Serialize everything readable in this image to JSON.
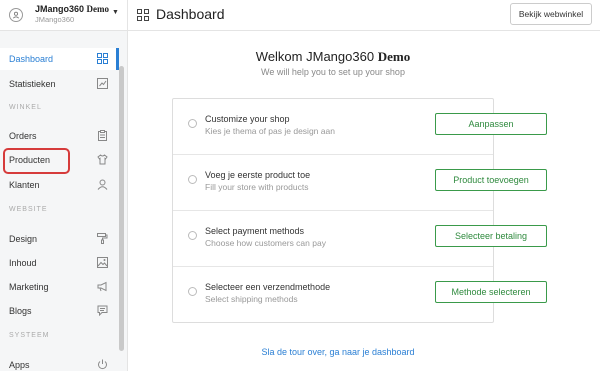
{
  "account": {
    "name": "JMango360",
    "name_suffix": "Demo",
    "subtitle": "JMango360"
  },
  "header": {
    "title": "Dashboard",
    "view_store_label": "Bekijk webwinkel"
  },
  "sidebar": {
    "items": [
      {
        "label": "Dashboard",
        "icon": "grid-icon"
      },
      {
        "label": "Statistieken",
        "icon": "chart-icon"
      },
      {
        "label": "Orders",
        "icon": "clipboard-icon"
      },
      {
        "label": "Producten",
        "icon": "shirt-icon"
      },
      {
        "label": "Klanten",
        "icon": "user-icon"
      },
      {
        "label": "Design",
        "icon": "paint-roller-icon"
      },
      {
        "label": "Inhoud",
        "icon": "image-icon"
      },
      {
        "label": "Marketing",
        "icon": "megaphone-icon"
      },
      {
        "label": "Blogs",
        "icon": "comment-icon"
      },
      {
        "label": "Apps",
        "icon": "power-icon"
      }
    ],
    "sections": {
      "winkel": "WINKEL",
      "website": "WEBSITE",
      "systeem": "SYSTEEM"
    }
  },
  "main": {
    "welcome_prefix": "Welkom",
    "welcome_name": "JMango360",
    "welcome_suffix": "Demo",
    "welcome_sub": "We will help you to set up your shop",
    "steps": [
      {
        "title": "Customize your shop",
        "subtitle": "Kies je thema of pas je design aan",
        "button": "Aanpassen"
      },
      {
        "title": "Voeg je eerste product toe",
        "subtitle": "Fill your store with products",
        "button": "Product toevoegen"
      },
      {
        "title": "Select payment methods",
        "subtitle": "Choose how customers can pay",
        "button": "Selecteer betaling"
      },
      {
        "title": "Selecteer een verzendmethode",
        "subtitle": "Select shipping methods",
        "button": "Methode selecteren"
      }
    ],
    "tour_link": "Sla de tour over, ga naar je dashboard"
  },
  "colors": {
    "accent": "#2a7fd4",
    "button_green": "#2f8a3e",
    "highlight": "#d63b3b"
  }
}
